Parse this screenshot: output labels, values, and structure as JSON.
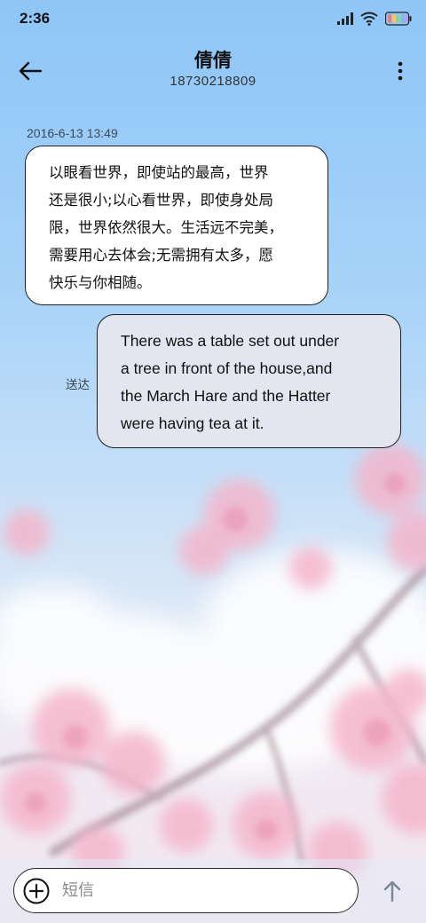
{
  "status_bar": {
    "time": "2:36",
    "icons": [
      "signal-icon",
      "wifi-icon",
      "battery-icon"
    ]
  },
  "header": {
    "contact_name": "倩倩",
    "phone_number": "18730218809",
    "back_icon": "back-arrow-icon",
    "more_icon": "more-vertical-icon"
  },
  "conversation": {
    "timestamp": "2016-6-13 13:49",
    "messages": [
      {
        "direction": "incoming",
        "lines": [
          "以眼看世界，即使站的最高，世界",
          "还是很小;以心看世界，即使身处局",
          "限，世界依然很大。生活远不完美，",
          "需要用心去体会;无需拥有太多，愿",
          "快乐与你相随。"
        ]
      },
      {
        "direction": "outgoing",
        "status": "送达",
        "lines": [
          "There was a table set out under",
          "a tree in front of the house,and",
          "the March Hare and the Hatter",
          "were having tea at it."
        ]
      }
    ]
  },
  "composer": {
    "placeholder": "短信",
    "value": "",
    "attach_icon": "add-circle-icon",
    "send_icon": "send-arrow-up-icon"
  },
  "colors": {
    "sky_top": "#8ec6f7",
    "blossom_pink": "#f4b6cb",
    "outgoing_bubble": "#e3e6f1",
    "incoming_bubble": "#ffffff"
  }
}
